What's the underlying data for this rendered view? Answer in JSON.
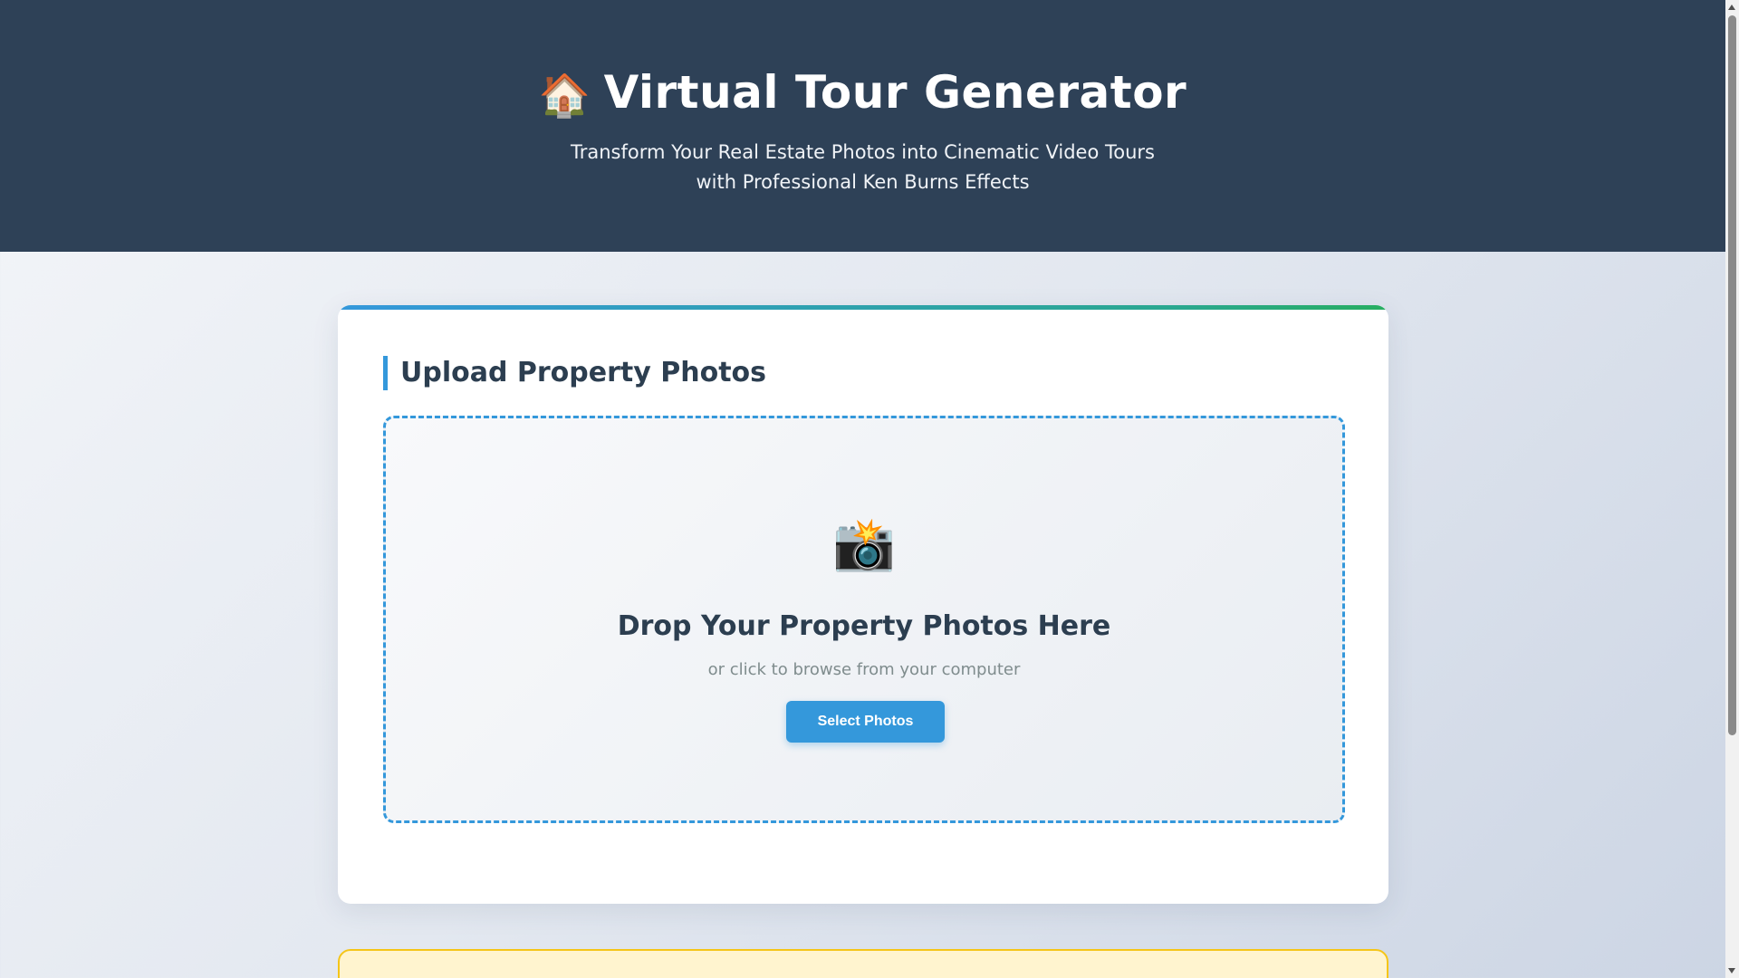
{
  "header": {
    "icon": "house-icon",
    "icon_glyph": "🏠",
    "title": "Virtual Tour Generator",
    "subtitle_line1": "Transform Your Real Estate Photos into Cinematic Video Tours",
    "subtitle_line2": "with Professional Ken Burns Effects"
  },
  "upload": {
    "section_title": "Upload Property Photos",
    "dropzone": {
      "icon": "camera-icon",
      "icon_glyph": "📸",
      "title": "Drop Your Property Photos Here",
      "subtitle": "or click to browse from your computer",
      "button_label": "Select Photos"
    }
  },
  "colors": {
    "header_bg": "#2e4157",
    "accent": "#3498db",
    "accent_green": "#27ae60",
    "notice_bg": "#fff4cf",
    "notice_border": "#f5c518",
    "text_dark": "#2c3e50",
    "text_muted": "#7f8c8d"
  }
}
